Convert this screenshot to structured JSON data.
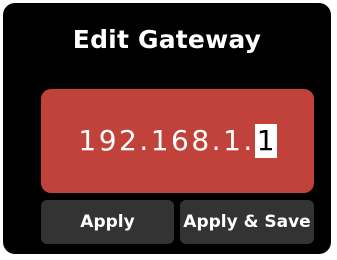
{
  "dialog": {
    "title": "Edit Gateway"
  },
  "ip_field": {
    "value_prefix": "192.168.1.",
    "value_cursor_char": "1",
    "background_color": "#c0423b"
  },
  "buttons": {
    "apply_label": "Apply",
    "apply_save_label": "Apply & Save"
  }
}
